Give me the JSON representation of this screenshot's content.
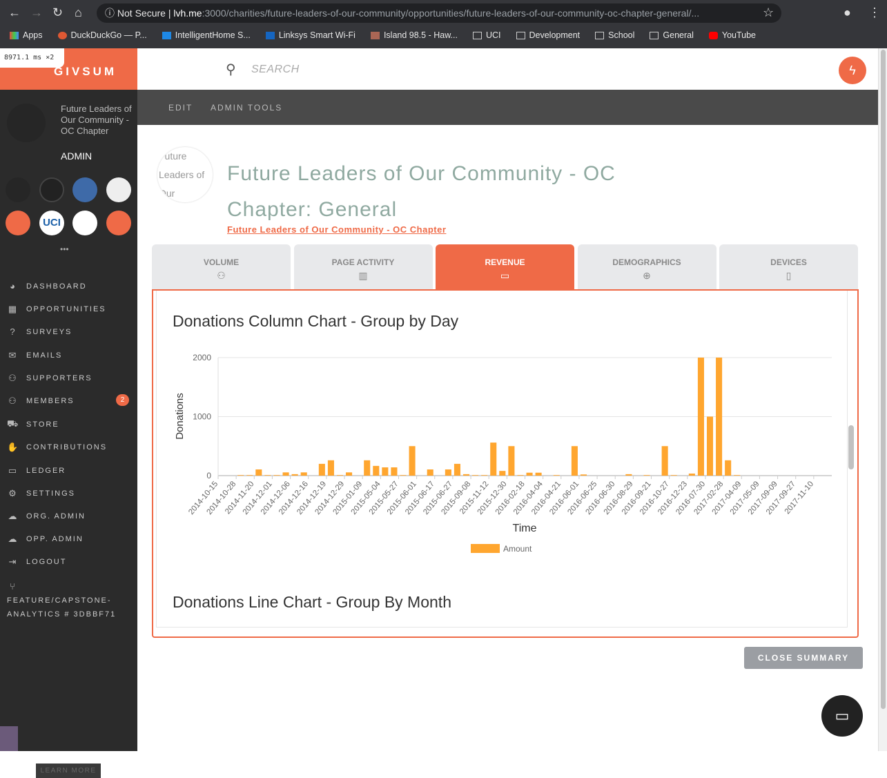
{
  "browser": {
    "not_secure": "Not Secure",
    "url_host": "lvh.me",
    "url_path": ":3000/charities/future-leaders-of-our-community/opportunities/future-leaders-of-our-community-oc-chapter-general/...",
    "bookmarks": [
      "Apps",
      "DuckDuckGo — P...",
      "IntelligentHome S...",
      "Linksys Smart Wi-Fi",
      "Island 98.5 - Haw...",
      "UCI",
      "Development",
      "School",
      "General",
      "YouTube"
    ],
    "timer": "8971.1 ms ×2"
  },
  "sidebar": {
    "logo": "GIVSUM",
    "org_name": "Future Leaders of Our Community - OC Chapter",
    "role": "ADMIN",
    "more": "•••",
    "items": [
      {
        "label": "DASHBOARD",
        "icon": "palette-icon"
      },
      {
        "label": "OPPORTUNITIES",
        "icon": "building-icon"
      },
      {
        "label": "SURVEYS",
        "icon": "question-icon"
      },
      {
        "label": "EMAILS",
        "icon": "mail-icon"
      },
      {
        "label": "SUPPORTERS",
        "icon": "people-icon"
      },
      {
        "label": "MEMBERS",
        "icon": "people-icon",
        "badge": "2"
      },
      {
        "label": "STORE",
        "icon": "cart-icon"
      },
      {
        "label": "CONTRIBUTIONS",
        "icon": "hand-icon"
      },
      {
        "label": "LEDGER",
        "icon": "card-icon"
      },
      {
        "label": "SETTINGS",
        "icon": "gear-icon"
      },
      {
        "label": "ORG. ADMIN",
        "icon": "cloud-icon"
      },
      {
        "label": "OPP. ADMIN",
        "icon": "cloud-icon"
      },
      {
        "label": "LOGOUT",
        "icon": "logout-icon"
      },
      {
        "label": "FEATURE/CAPSTONE-ANALYTICS # 3DBBF71",
        "icon": "branch-icon"
      }
    ],
    "learn_more": "LEARN MORE",
    "org_avatars": [
      "UCI"
    ]
  },
  "topbar": {
    "search_placeholder": "SEARCH"
  },
  "admin_bar": {
    "edit": "EDIT",
    "admin_tools": "ADMIN TOOLS"
  },
  "page": {
    "org_image_alt": "Future Leaders of Our",
    "title": "Future Leaders of Our Community - OC Chapter: General",
    "org_link": "Future Leaders of Our Community - OC Chapter"
  },
  "tabs": [
    {
      "label": "VOLUME",
      "icon": "people-icon"
    },
    {
      "label": "PAGE ACTIVITY",
      "icon": "bars-icon"
    },
    {
      "label": "REVENUE",
      "icon": "card-icon",
      "active": true
    },
    {
      "label": "DEMOGRAPHICS",
      "icon": "globe-icon"
    },
    {
      "label": "DEVICES",
      "icon": "phone-icon"
    }
  ],
  "chart_titles": {
    "column": "Donations Column Chart - Group by Day",
    "line": "Donations Line Chart - Group By Month"
  },
  "close_summary": "CLOSE SUMMARY",
  "colors": {
    "accent": "#ef6a47",
    "bar": "#ffa62f",
    "sidebar": "#2b2b2b"
  },
  "chart_data": {
    "type": "bar",
    "xlabel": "Time",
    "ylabel": "Donations",
    "ylim": [
      0,
      2000
    ],
    "yticks": [
      0,
      1000,
      2000
    ],
    "grid": true,
    "legend": "bottom",
    "categories": [
      "2014-10-15",
      "",
      "2014-10-28",
      "",
      "2014-11-20",
      "",
      "2014-12-01",
      "",
      "2014-12-06",
      "",
      "2014-12-16",
      "",
      "2014-12-19",
      "",
      "2014-12-29",
      "",
      "2015-01-09",
      "",
      "2015-05-04",
      "",
      "2015-05-27",
      "",
      "2015-06-01",
      "",
      "2015-06-17",
      "",
      "2015-06-27",
      "",
      "2015-09-08",
      "",
      "2015-11-12",
      "",
      "2015-12-30",
      "",
      "2016-02-18",
      "",
      "2016-04-04",
      "",
      "2016-04-21",
      "",
      "2016-06-01",
      "",
      "2016-06-25",
      "",
      "2016-06-30",
      "",
      "2016-08-29",
      "",
      "2016-09-21",
      "",
      "2016-10-27",
      "",
      "2016-12-23",
      "",
      "2016-07-30",
      "",
      "2017-02-28",
      "",
      "2017-04-09",
      "",
      "2017-05-09",
      "",
      "2017-09-09",
      "",
      "2017-09-27",
      "",
      "2017-11-10",
      ""
    ],
    "series": [
      {
        "name": "Amount",
        "values": [
          0,
          0,
          10,
          10,
          105,
          10,
          10,
          55,
          25,
          55,
          0,
          200,
          260,
          10,
          55,
          0,
          260,
          165,
          140,
          140,
          10,
          500,
          0,
          105,
          0,
          105,
          200,
          25,
          10,
          10,
          560,
          80,
          500,
          10,
          50,
          50,
          0,
          10,
          0,
          500,
          20,
          0,
          0,
          0,
          0,
          25,
          0,
          10,
          0,
          500,
          10,
          0,
          35,
          2000,
          1000,
          2000,
          260,
          10,
          0,
          0,
          0,
          0,
          0,
          0,
          0,
          0,
          0,
          0
        ]
      }
    ]
  }
}
